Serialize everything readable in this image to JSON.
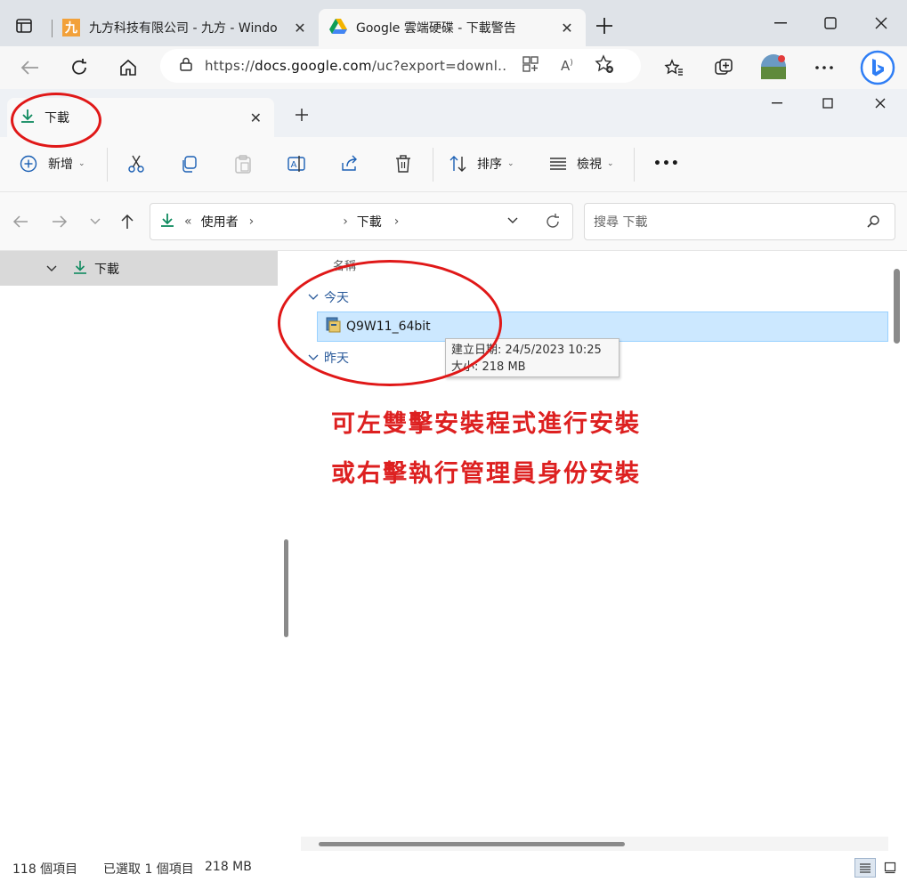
{
  "browser": {
    "tabs": [
      {
        "title": "九方科技有限公司 - 九方 - Windo",
        "favicon": "jiufang-logo-icon",
        "close": "✕"
      },
      {
        "title": "Google 雲端硬碟 - 下載警告",
        "favicon": "google-drive-icon",
        "close": "✕"
      }
    ],
    "url_prefix": "https://",
    "url_host": "docs.google.com",
    "url_path": "/uc?export=downl...",
    "icons": [
      "sidebar-icon",
      "back-icon",
      "refresh-icon",
      "home-icon",
      "lock-icon",
      "apps-icon",
      "read-aloud-icon",
      "add-favorite-icon",
      "favorites-icon",
      "collections-icon",
      "profile-avatar",
      "more-icon",
      "bing-icon"
    ]
  },
  "explorer": {
    "tab_title": "下載",
    "toolbar": {
      "new_label": "新增",
      "sort_label": "排序",
      "view_label": "檢視",
      "more_label": "•••"
    },
    "breadcrumb": {
      "prefix": "«",
      "parent": "使用者",
      "sep": "›",
      "current": "下載"
    },
    "search_placeholder": "搜尋 下載",
    "nav_pane": {
      "selected_item": "下載"
    },
    "content": {
      "column_name": "名稱",
      "groups": [
        {
          "label": "今天"
        },
        {
          "label": "昨天"
        }
      ],
      "file": {
        "name": "Q9W11_64bit"
      },
      "tooltip": {
        "line1": "建立日期: 24/5/2023 10:25",
        "line2": "大小: 218 MB"
      },
      "annotation_line1": "可左雙擊安裝程式進行安裝",
      "annotation_line2": "或右擊執行管理員身份安裝"
    },
    "status": {
      "item_count": "118 個項目",
      "selected": "已選取 1 個項目",
      "selected_size": "218 MB"
    }
  },
  "colors": {
    "accent_green": "#0f8a5f",
    "annotation_red": "#dd2020",
    "selection_blue": "#cce8ff"
  }
}
